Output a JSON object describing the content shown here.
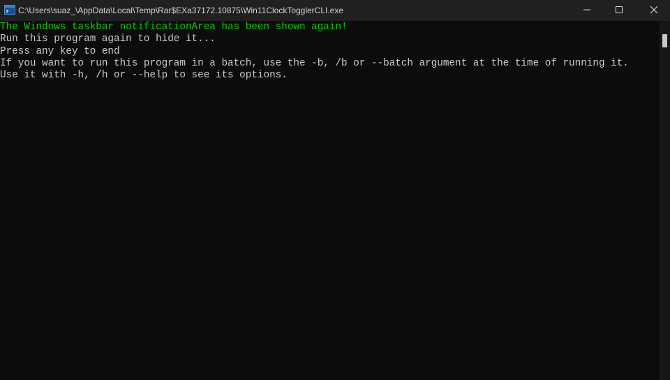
{
  "window": {
    "title": "C:\\Users\\suaz_\\AppData\\Local\\Temp\\Rar$EXa37172.10875\\Win11ClockTogglerCLI.exe",
    "app_icon": "console-app-icon",
    "controls": {
      "minimize_icon": "minimize-icon",
      "maximize_icon": "maximize-icon",
      "close_icon": "close-icon"
    }
  },
  "console": {
    "lines": [
      "The Windows taskbar notificationArea has been shown again!",
      "Run this program again to hide it...",
      "Press any key to end",
      "If you want to run this program in a batch, use the -b, /b or --batch argument at the time of running it.",
      "Use it with -h, /h or --help to see its options."
    ],
    "colors": {
      "background": "#0c0c0c",
      "default_text": "#cccccc",
      "success_text": "#16c60c"
    }
  }
}
